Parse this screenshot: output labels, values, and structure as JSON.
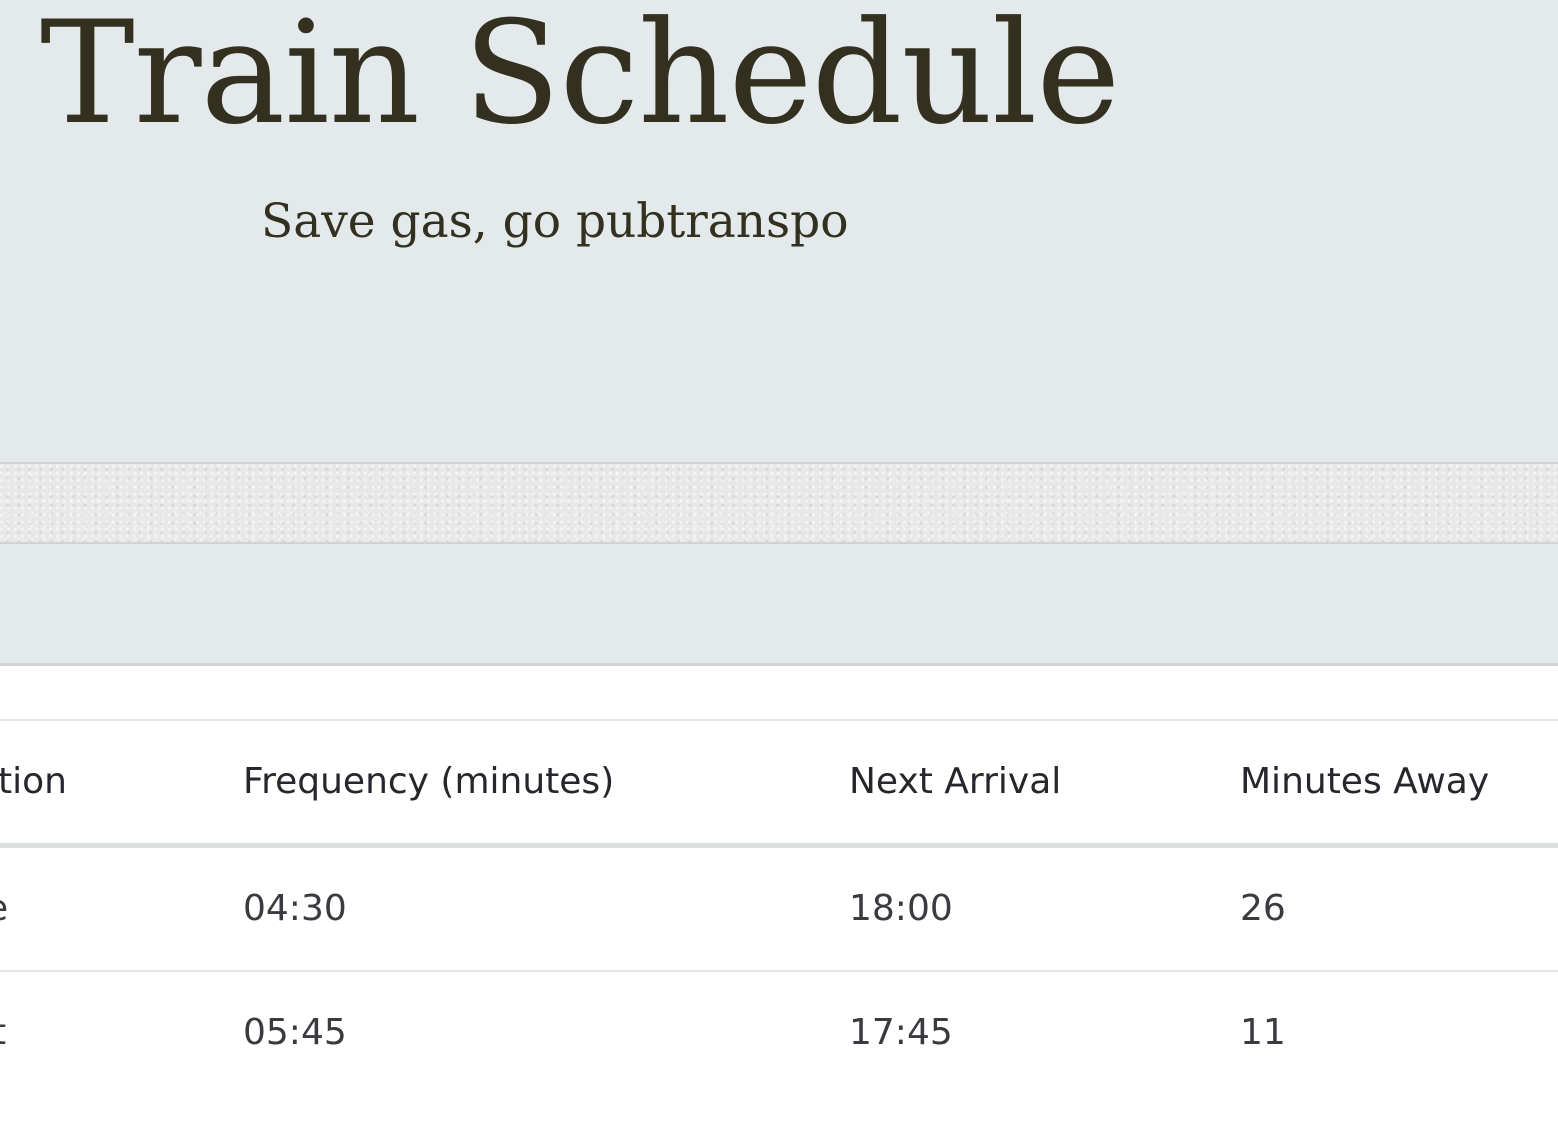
{
  "header": {
    "title": "Train Schedule",
    "subtitle": "Save gas, go pubtranspo"
  },
  "table": {
    "columns": [
      "tion",
      "Frequency (minutes)",
      "Next Arrival",
      "Minutes Away"
    ],
    "rows": [
      {
        "destination": "e",
        "frequency": "04:30",
        "next_arrival": "18:00",
        "minutes_away": "26"
      },
      {
        "destination": "t",
        "frequency": "05:45",
        "next_arrival": "17:45",
        "minutes_away": "11"
      }
    ]
  },
  "colors": {
    "jumbotron_bg": "#e4e9ec",
    "title_text": "#33301f",
    "table_text": "#2c2c33"
  }
}
